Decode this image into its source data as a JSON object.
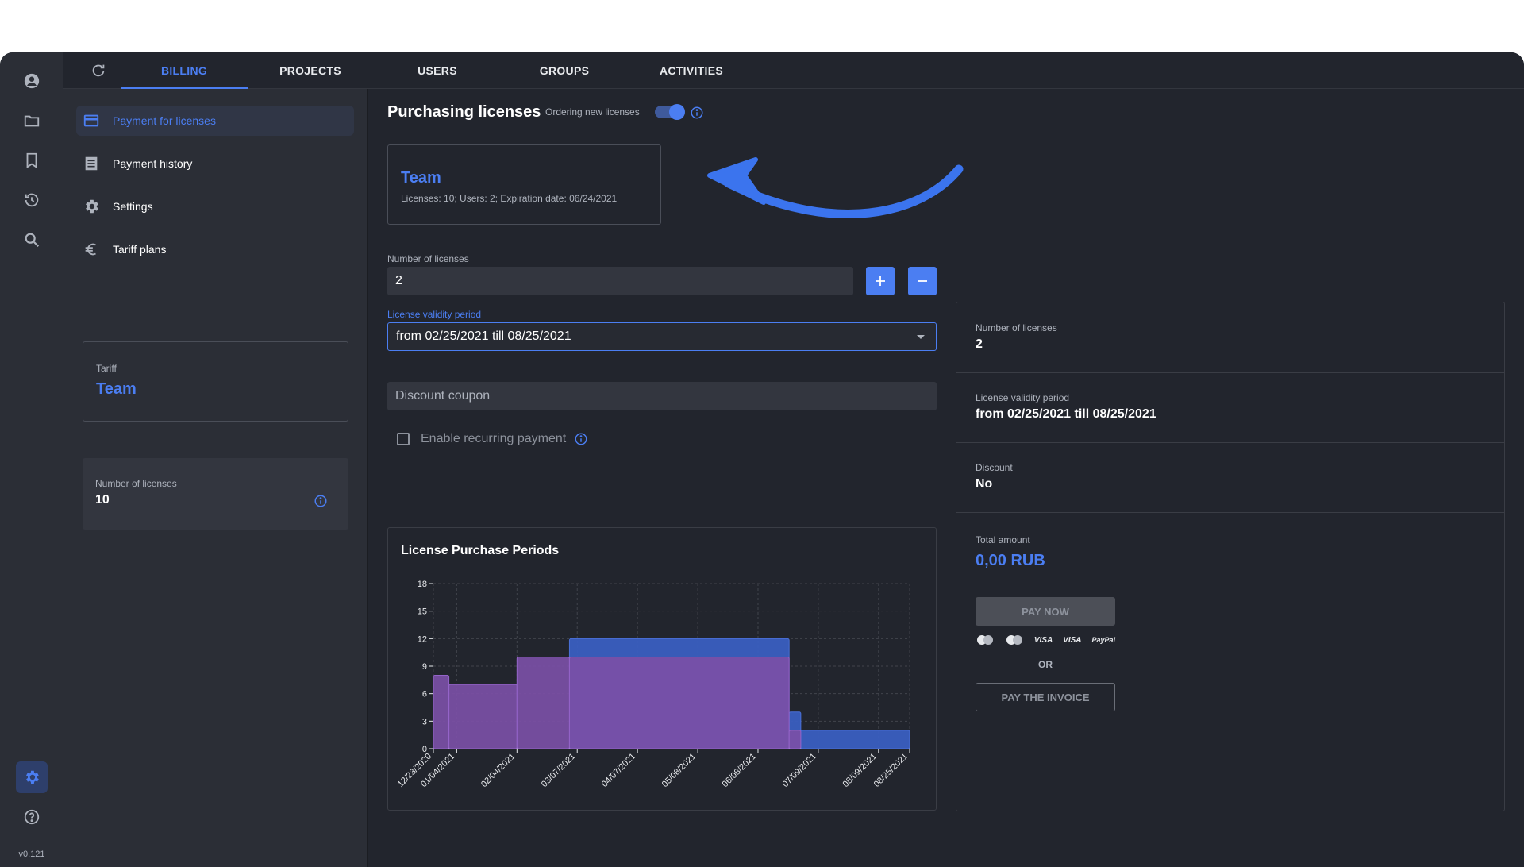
{
  "app": {
    "version": "v0.121",
    "colors": {
      "accent": "#4b7ef2",
      "background": "#22252d",
      "panel": "#2b2e36",
      "series_periods": "#7b4fa6",
      "series_new": "#3a5ec0",
      "annotation": "#3b74ee"
    }
  },
  "rail": {
    "icons": [
      "account-icon",
      "folder-icon",
      "bookmark-icon",
      "history-icon",
      "search-icon",
      "settings-icon",
      "help-icon"
    ]
  },
  "tabs": [
    {
      "label": "BILLING",
      "active": true
    },
    {
      "label": "PROJECTS",
      "active": false
    },
    {
      "label": "USERS",
      "active": false
    },
    {
      "label": "GROUPS",
      "active": false
    },
    {
      "label": "ACTIVITIES",
      "active": false
    }
  ],
  "sidebar": {
    "items": [
      {
        "label": "Payment for licenses",
        "icon": "credit-card-icon",
        "active": true
      },
      {
        "label": "Payment history",
        "icon": "receipt-list-icon",
        "active": false
      },
      {
        "label": "Settings",
        "icon": "gear-icon",
        "active": false
      },
      {
        "label": "Tariff plans",
        "icon": "euro-icon",
        "active": false
      }
    ],
    "tariff": {
      "label": "Tariff",
      "value": "Team"
    },
    "licenses": {
      "label": "Number of licenses",
      "value": "10"
    }
  },
  "main": {
    "title": "Purchasing licenses",
    "toggle_label": "Ordering new licenses",
    "toggle_on": true,
    "plan": {
      "name": "Team",
      "meta": "Licenses: 10; Users: 2; Expiration date: 06/24/2021"
    },
    "num_licenses": {
      "label": "Number of licenses",
      "value": "2"
    },
    "period": {
      "label": "License validity period",
      "value": "from 02/25/2021 till 08/25/2021"
    },
    "coupon": {
      "placeholder": "Discount coupon"
    },
    "recurring": {
      "label": "Enable recurring payment",
      "checked": false
    }
  },
  "summary": {
    "licenses": {
      "label": "Number of licenses",
      "value": "2"
    },
    "period": {
      "label": "License validity period",
      "value": "from 02/25/2021 till 08/25/2021"
    },
    "discount": {
      "label": "Discount",
      "value": "No"
    },
    "total": {
      "label": "Total amount",
      "value": "0,00 RUB"
    },
    "pay_now": "PAY NOW",
    "payment_methods": [
      "mastercard-icon",
      "maestro-icon",
      "VISA",
      "VISA",
      "PayPal"
    ],
    "or": "OR",
    "pay_invoice": "PAY THE INVOICE"
  },
  "chart_data": {
    "type": "area",
    "title": "License Purchase Periods",
    "x_ticks": [
      "12/23/2020",
      "01/04/2021",
      "02/04/2021",
      "03/07/2021",
      "04/07/2021",
      "05/08/2021",
      "06/08/2021",
      "07/09/2021",
      "08/09/2021",
      "08/25/2021"
    ],
    "y_ticks": [
      0,
      3,
      6,
      9,
      12,
      15,
      18
    ],
    "ylim": [
      0,
      18
    ],
    "grid": true,
    "series": [
      {
        "color": "#7b4fa6",
        "segments": [
          {
            "from": "12/23/2020",
            "to": "12/31/2020",
            "value": 8
          },
          {
            "from": "12/31/2020",
            "to": "02/04/2021",
            "value": 7
          },
          {
            "from": "02/04/2021",
            "to": "03/03/2021",
            "value": 10
          },
          {
            "from": "03/03/2021",
            "to": "06/24/2021",
            "value": 10
          },
          {
            "from": "06/24/2021",
            "to": "06/30/2021",
            "value": 2
          }
        ]
      },
      {
        "color": "#3a5ec0",
        "segments": [
          {
            "from": "03/03/2021",
            "to": "06/24/2021",
            "value": 12
          },
          {
            "from": "06/24/2021",
            "to": "06/30/2021",
            "value": 4
          },
          {
            "from": "06/30/2021",
            "to": "08/25/2021",
            "value": 2
          }
        ]
      }
    ]
  }
}
